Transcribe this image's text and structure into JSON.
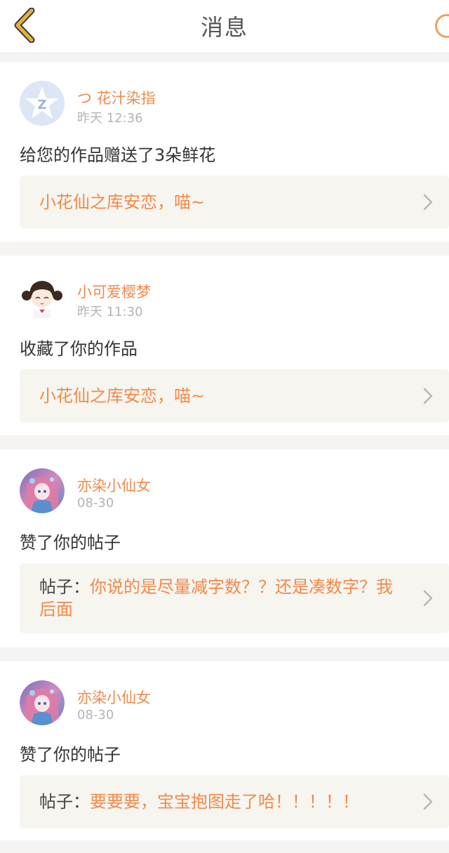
{
  "header": {
    "title": "消息"
  },
  "icons": {
    "back": "chevron-left-icon",
    "right": "circle-icon",
    "ref_arrow": "chevron-right-icon"
  },
  "colors": {
    "accent": "#f08a4b",
    "back_icon": "#e2b23a",
    "ref_box_bg": "#f6f5ef",
    "page_bg": "#f6f4f2"
  },
  "messages": [
    {
      "user": "つ 花汁染指",
      "time": "昨天 12:36",
      "action": "给您的作品赠送了3朵鲜花",
      "ref_prefix": "",
      "ref_text": "小花仙之库安恋，喵~",
      "avatar": "qq-default-avatar-icon"
    },
    {
      "user": "小可爱樱梦",
      "time": "昨天 11:30",
      "action": "收藏了你的作品",
      "ref_prefix": "",
      "ref_text": "小花仙之库安恋，喵~",
      "avatar": "cartoon-girl-avatar"
    },
    {
      "user": "亦染小仙女",
      "time": "08-30",
      "action": "赞了你的帖子",
      "ref_prefix": "帖子：",
      "ref_text": "你说的是尽量减字数？？还是凑数字？我后面",
      "avatar": "anime-girl-avatar"
    },
    {
      "user": "亦染小仙女",
      "time": "08-30",
      "action": "赞了你的帖子",
      "ref_prefix": "帖子：",
      "ref_text": "要要要，宝宝抱图走了哈！！！！！",
      "avatar": "anime-girl-avatar"
    }
  ]
}
